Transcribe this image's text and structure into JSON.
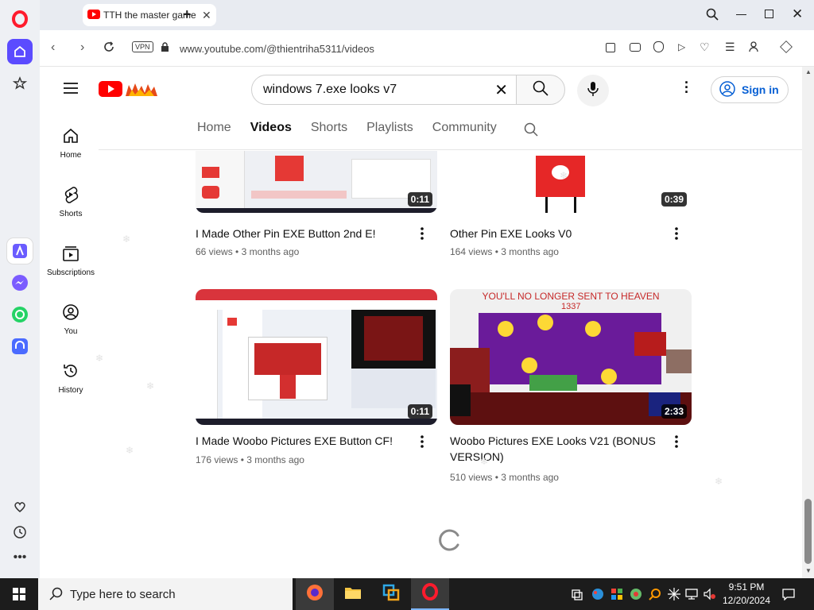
{
  "browser": {
    "tab_title": "TTH the master gamer",
    "url": "www.youtube.com/@thientriha5311/videos",
    "vpn_label": "VPN"
  },
  "youtube": {
    "search_query": "windows 7.exe looks v7",
    "sign_in_label": "Sign in",
    "guide": [
      {
        "label": "Home",
        "icon": "home-icon"
      },
      {
        "label": "Shorts",
        "icon": "shorts-icon"
      },
      {
        "label": "Subscriptions",
        "icon": "subscriptions-icon"
      },
      {
        "label": "You",
        "icon": "you-icon"
      },
      {
        "label": "History",
        "icon": "history-icon"
      }
    ],
    "tabs": [
      "Home",
      "Videos",
      "Shorts",
      "Playlists",
      "Community"
    ],
    "active_tab": "Videos",
    "videos": [
      {
        "title": "I Made Other Pin EXE Button 2nd E!",
        "views": "66 views",
        "age": "3 months ago",
        "duration": "0:11"
      },
      {
        "title": "Other Pin EXE Looks V0",
        "views": "164 views",
        "age": "3 months ago",
        "duration": "0:39"
      },
      {
        "title": "I Made Woobo Pictures EXE Button CF!",
        "views": "176 views",
        "age": "3 months ago",
        "duration": "0:11"
      },
      {
        "title": "Woobo Pictures EXE Looks V21 (BONUS VERSION)",
        "views": "510 views",
        "age": "3 months ago",
        "duration": "2:33",
        "thumb_text": "YOU'LL NO LONGER SENT TO HEAVEN",
        "thumb_subtext": "1337"
      }
    ],
    "meta_separator": "•"
  },
  "taskbar": {
    "search_placeholder": "Type here to search",
    "time": "9:51 PM",
    "date": "12/20/2024"
  },
  "colors": {
    "youtube_red": "#ff0000",
    "opera_red": "#ff1b2d",
    "link_blue": "#065fd4",
    "sidebar_active": "#5b4bff"
  }
}
